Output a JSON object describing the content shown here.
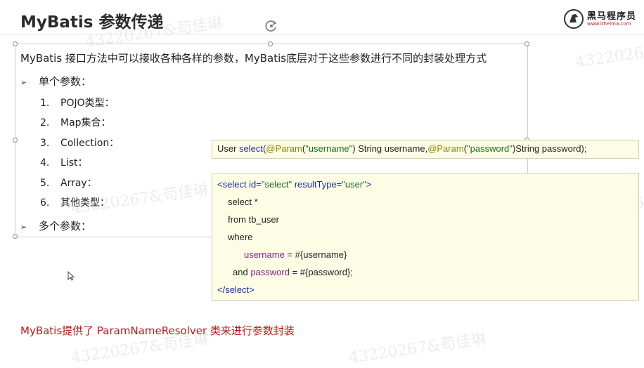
{
  "header": {
    "title": "MyBatis 参数传递",
    "logo_text": "黑马程序员",
    "logo_url": "www.itheima.com"
  },
  "content": {
    "intro": "MyBatis 接口方法中可以接收各种各样的参数，MyBatis底层对于这些参数进行不同的封装处理方式",
    "single_label": "单个参数：",
    "items": [
      {
        "num": "1.",
        "label": "POJO类型："
      },
      {
        "num": "2.",
        "label": "Map集合："
      },
      {
        "num": "3.",
        "label": "Collection："
      },
      {
        "num": "4.",
        "label": "List："
      },
      {
        "num": "5.",
        "label": "Array："
      },
      {
        "num": "6.",
        "label": "其他类型："
      }
    ],
    "multi_label": "多个参数："
  },
  "code1": {
    "p1": "User ",
    "p2": "select(",
    "p3": "@Param",
    "p4": "(",
    "p5": "\"username\"",
    "p6": ") String username,",
    "p7": "@Param",
    "p8": "(",
    "p9": "\"password\"",
    "p10": ")String password);"
  },
  "code2": {
    "l1a": "<select ",
    "l1b": "id=",
    "l1c": "\"select\"",
    "l1d": " resultType=",
    "l1e": "\"user\"",
    "l1f": ">",
    "l2": "select *",
    "l3": "from tb_user",
    "l4": "where",
    "l5a": "username",
    "l5b": " = #{username}",
    "l6a": "and ",
    "l6b": "password",
    "l6c": " = #{password};",
    "l7": "</select>"
  },
  "footer": {
    "text": "MyBatis提供了 ParamNameResolver 类来进行参数封装"
  },
  "watermarks": [
    "4322026",
    "4322026",
    "43220267&苟佳琳",
    "43220267&苟佳琳",
    "43220267&苟佳琳",
    "43220267&苟佳琳",
    "43220267&苟佳琳"
  ],
  "colors": {
    "footer": "#c01818",
    "code_bg": "#fdfde6",
    "logo_accent": "#c8151d"
  }
}
